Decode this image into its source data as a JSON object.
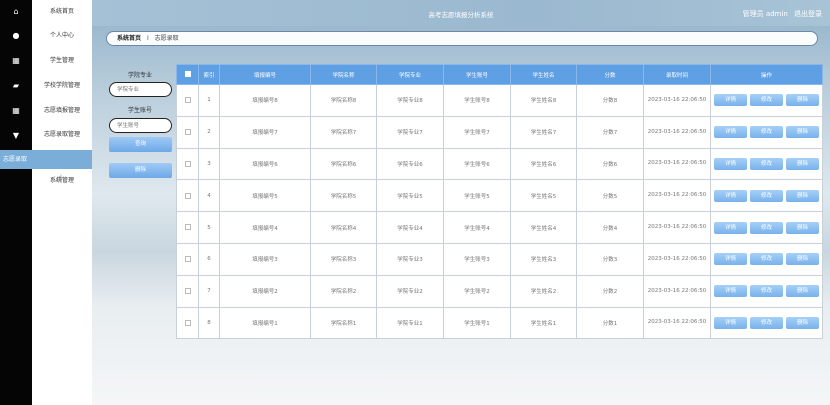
{
  "app": {
    "title": "高考志愿填报分析系统",
    "user_label": "管理员 admin",
    "logout_label": "退出登录"
  },
  "rail": {
    "icons": [
      "home-icon",
      "user-icon",
      "grid-icon",
      "briefcase-icon",
      "grid-icon",
      "trophy-icon"
    ]
  },
  "sidebar": {
    "items": [
      {
        "label": "系统首页"
      },
      {
        "label": "个人中心"
      },
      {
        "label": "学生管理"
      },
      {
        "label": "学校学院管理"
      },
      {
        "label": "志愿填报管理"
      },
      {
        "label": "志愿录取管理"
      },
      {
        "label": "志愿录取"
      },
      {
        "label": "系统管理"
      }
    ]
  },
  "breadcrumb": {
    "home": "系统首页",
    "separator": "I",
    "current": "志愿录取"
  },
  "search": {
    "major_label": "学院专业",
    "major_placeholder": "学院专业",
    "student_label": "学生账号",
    "student_placeholder": "学生账号",
    "query_button": "查询",
    "delete_button": "删除"
  },
  "table": {
    "headers": [
      "索引",
      "填报编号",
      "学院名称",
      "学院专业",
      "学生账号",
      "学生姓名",
      "分数",
      "录取时间",
      "操作"
    ],
    "rows": [
      {
        "index": "1",
        "code": "填报编号8",
        "college": "学院名称8",
        "major": "学院专业8",
        "account": "学生账号8",
        "name": "学生姓名8",
        "score": "分数8",
        "time": "2023-03-16 22:06:50"
      },
      {
        "index": "2",
        "code": "填报编号7",
        "college": "学院名称7",
        "major": "学院专业7",
        "account": "学生账号7",
        "name": "学生姓名7",
        "score": "分数7",
        "time": "2023-03-16 22:06:50"
      },
      {
        "index": "3",
        "code": "填报编号6",
        "college": "学院名称6",
        "major": "学院专业6",
        "account": "学生账号6",
        "name": "学生姓名6",
        "score": "分数6",
        "time": "2023-03-16 22:06:50"
      },
      {
        "index": "4",
        "code": "填报编号5",
        "college": "学院名称5",
        "major": "学院专业5",
        "account": "学生账号5",
        "name": "学生姓名5",
        "score": "分数5",
        "time": "2023-03-16 22:06:50"
      },
      {
        "index": "5",
        "code": "填报编号4",
        "college": "学院名称4",
        "major": "学院专业4",
        "account": "学生账号4",
        "name": "学生姓名4",
        "score": "分数4",
        "time": "2023-03-16 22:06:50"
      },
      {
        "index": "6",
        "code": "填报编号3",
        "college": "学院名称3",
        "major": "学院专业3",
        "account": "学生账号3",
        "name": "学生姓名3",
        "score": "分数3",
        "time": "2023-03-16 22:06:50"
      },
      {
        "index": "7",
        "code": "填报编号2",
        "college": "学院名称2",
        "major": "学院专业2",
        "account": "学生账号2",
        "name": "学生姓名2",
        "score": "分数2",
        "time": "2023-03-16 22:06:50"
      },
      {
        "index": "8",
        "code": "填报编号1",
        "college": "学院名称1",
        "major": "学院专业1",
        "account": "学生账号1",
        "name": "学生姓名1",
        "score": "分数1",
        "time": "2023-03-16 22:06:50"
      }
    ],
    "actions": {
      "detail": "详情",
      "edit": "修改",
      "delete": "删除"
    }
  }
}
